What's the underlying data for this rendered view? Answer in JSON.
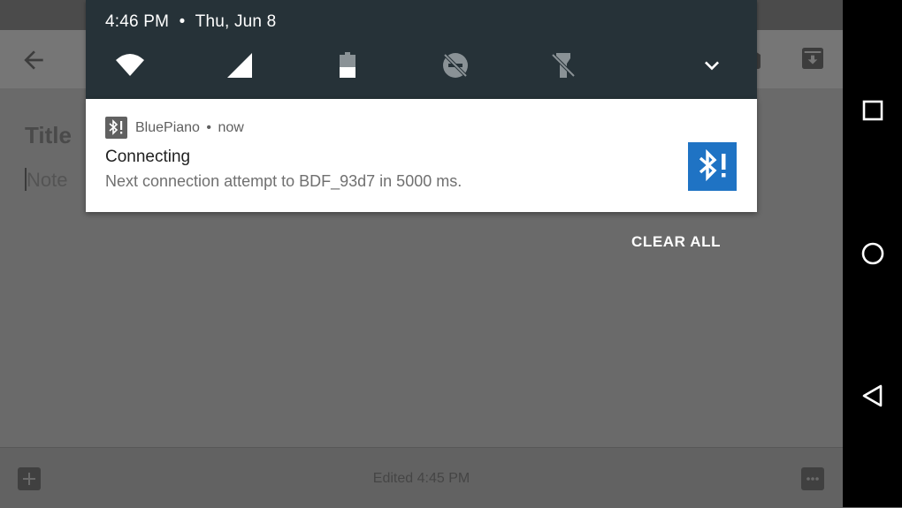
{
  "background_app": {
    "note_title": "Title",
    "note_body_placeholder": "Note",
    "edited_text": "Edited 4:45 PM",
    "icons": [
      "back-arrow-icon",
      "reminder-icon",
      "archive-icon",
      "add-box-icon",
      "more-icon"
    ]
  },
  "shade": {
    "time": "4:46 PM",
    "separator": "•",
    "date": "Thu, Jun 8",
    "quick_settings": [
      "wifi-icon",
      "cell-signal-icon",
      "battery-icon",
      "do-not-disturb-off-icon",
      "flashlight-off-icon",
      "expand-icon"
    ]
  },
  "notification": {
    "app_name": "BluePiano",
    "app_separator": "•",
    "time": "now",
    "title": "Connecting",
    "text": "Next connection attempt to BDF_93d7 in 5000 ms.",
    "app_icon": "bluetooth-alert-icon",
    "large_icon": "bluetooth-alert-icon",
    "large_icon_color": "#1f73c4"
  },
  "actions": {
    "clear_all": "CLEAR ALL"
  },
  "navbar": {
    "buttons": [
      "recents-icon",
      "home-icon",
      "back-icon"
    ]
  },
  "colors": {
    "shade_header": "#263238",
    "navbar": "#000000",
    "scrim": "#6a6a6a"
  }
}
